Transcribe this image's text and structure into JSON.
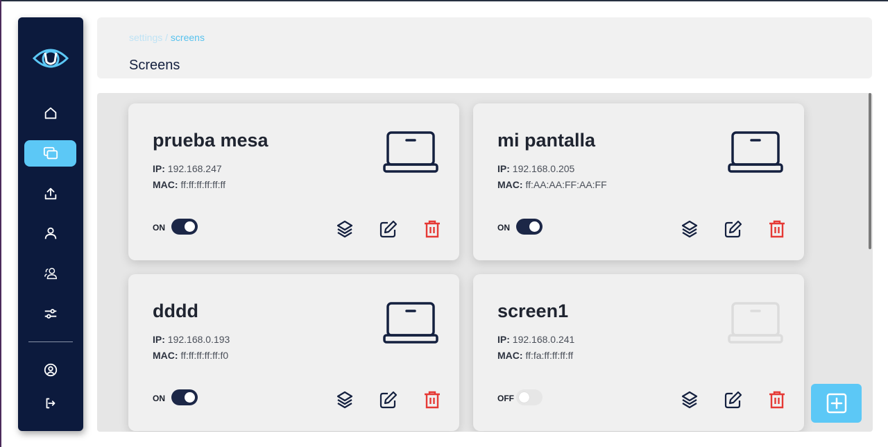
{
  "breadcrumb": {
    "parent": "settings",
    "separator": " / ",
    "current": "screens"
  },
  "page_title": "Screens",
  "sidebar": {
    "items": [
      {
        "icon": "home-icon"
      },
      {
        "icon": "screens-icon",
        "active": true
      },
      {
        "icon": "upload-icon"
      },
      {
        "icon": "user-icon"
      },
      {
        "icon": "users-icon"
      },
      {
        "icon": "sliders-icon"
      },
      {
        "icon": "account-circle-icon"
      },
      {
        "icon": "logout-icon"
      }
    ]
  },
  "labels": {
    "ip": "IP:",
    "mac": "MAC:"
  },
  "screens": [
    {
      "name": "prueba mesa",
      "ip": "192.168.247",
      "mac": "ff:ff:ff:ff:ff:ff",
      "status": "ON",
      "on": true
    },
    {
      "name": "mi pantalla",
      "ip": "192.168.0.205",
      "mac": "ff:AA:AA:FF:AA:FF",
      "status": "ON",
      "on": true
    },
    {
      "name": "dddd",
      "ip": "192.168.0.193",
      "mac": "ff:ff:ff:ff:ff:f0",
      "status": "ON",
      "on": true
    },
    {
      "name": "screen1",
      "ip": "192.168.0.241",
      "mac": "ff:fa:ff:ff:ff:ff",
      "status": "OFF",
      "on": false
    }
  ],
  "colors": {
    "sidebar_bg": "#0c1a3d",
    "accent": "#5cc8f6",
    "toggle_on": "#1c2747",
    "delete": "#e53935",
    "icon_dark": "#14203f"
  }
}
